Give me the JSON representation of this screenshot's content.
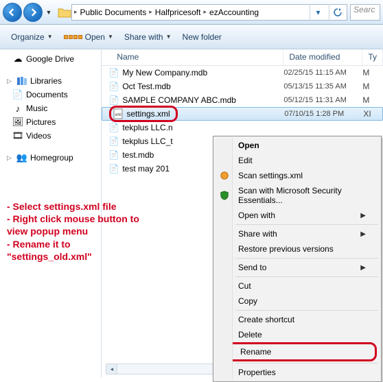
{
  "nav": {
    "crumb1": "Public Documents",
    "crumb2": "Halfpricesoft",
    "crumb3": "ezAccounting",
    "search_placeholder": "Searc"
  },
  "toolbar": {
    "organize": "Organize",
    "open": "Open",
    "share": "Share with",
    "newfolder": "New folder"
  },
  "sidebar": {
    "google": "Google Drive",
    "libraries": "Libraries",
    "documents": "Documents",
    "music": "Music",
    "pictures": "Pictures",
    "videos": "Videos",
    "homegroup": "Homegroup"
  },
  "cols": {
    "name": "Name",
    "date": "Date modified",
    "type": "Ty"
  },
  "files": [
    {
      "name": "My New Company.mdb",
      "date": "02/25/15 11:15 AM",
      "type": "M"
    },
    {
      "name": "Oct Test.mdb",
      "date": "05/13/15 11:35 AM",
      "type": "M"
    },
    {
      "name": "SAMPLE COMPANY ABC.mdb",
      "date": "05/12/15 11:31 AM",
      "type": "M"
    },
    {
      "name": "settings.xml",
      "date": "07/10/15 1:28 PM",
      "type": "XI"
    },
    {
      "name": "tekplus LLC.n",
      "date": "",
      "type": ""
    },
    {
      "name": "tekplus LLC_t",
      "date": "",
      "type": ""
    },
    {
      "name": "test.mdb",
      "date": "",
      "type": ""
    },
    {
      "name": "test may 201",
      "date": "",
      "type": ""
    }
  ],
  "ctx": {
    "open": "Open",
    "edit": "Edit",
    "scan": "Scan settings.xml",
    "scanmse": "Scan with Microsoft Security Essentials...",
    "openwith": "Open with",
    "sharewith": "Share with",
    "restore": "Restore previous versions",
    "sendto": "Send to",
    "cut": "Cut",
    "copy": "Copy",
    "shortcut": "Create shortcut",
    "delete": "Delete",
    "rename": "Rename",
    "properties": "Properties"
  },
  "annotation": {
    "l1": "- Select settings.xml file",
    "l2": "- Right click mouse button to view popup menu",
    "l3": "- Rename it to \"settings_old.xml\""
  }
}
